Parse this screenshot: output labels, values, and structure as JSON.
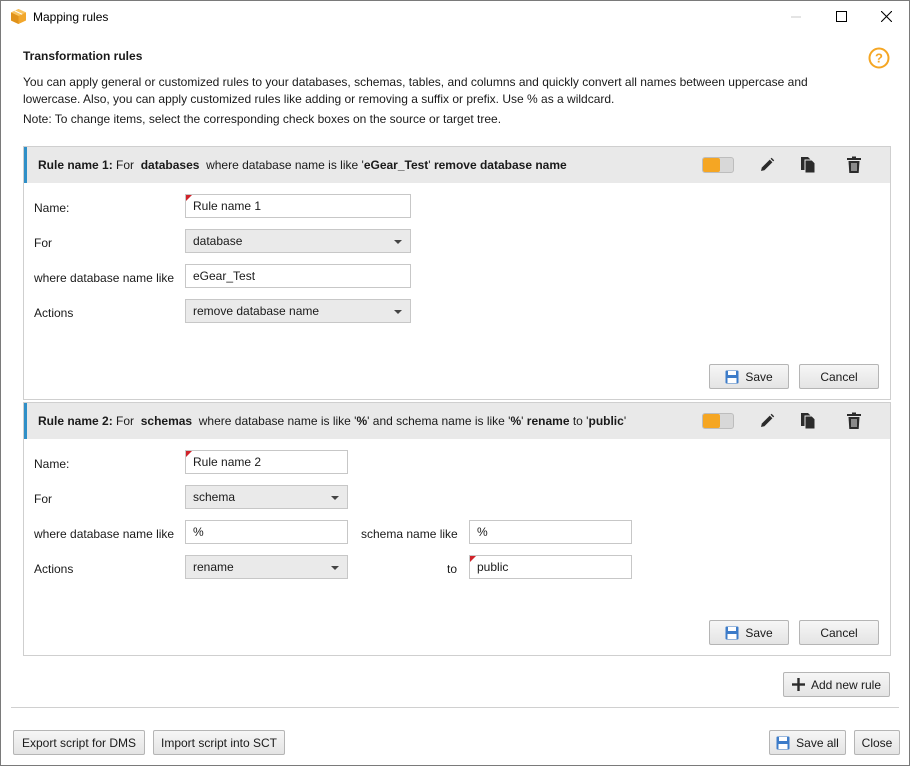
{
  "window": {
    "title": "Mapping rules"
  },
  "section": {
    "title": "Transformation rules",
    "description": "You can apply general or customized rules to your databases, schemas, tables, and columns and quickly convert all names between uppercase and lowercase. Also, you can apply customized rules like adding or removing a suffix or prefix. Use % as a wildcard.",
    "note": "Note: To change items, select the corresponding check boxes on the source or target tree."
  },
  "rule1": {
    "head": {
      "name": "Rule name 1:",
      "for_word": "For",
      "object": "databases",
      "mid": "where database name is like '",
      "pattern": "eGear_Test",
      "q": "'",
      "action": "remove database name"
    },
    "name_label": "Name:",
    "name_value": "Rule name 1",
    "for_label": "For",
    "for_value": "database",
    "where_label": "where database name like",
    "where_value": "eGear_Test",
    "actions_label": "Actions",
    "actions_value": "remove database name",
    "save": "Save",
    "cancel": "Cancel"
  },
  "rule2": {
    "head": {
      "name": "Rule name 2:",
      "for_word": "For",
      "object": "schemas",
      "mid1": "where database name is like '",
      "db_pattern": "%",
      "mid2": "' and schema name is like '",
      "schema_pattern": "%",
      "q": "'",
      "action": "rename",
      "to_word": "to '",
      "target": "public",
      "q2": "'"
    },
    "name_label": "Name:",
    "name_value": "Rule name 2",
    "for_label": "For",
    "for_value": "schema",
    "where_label": "where database name like",
    "where_value": "%",
    "schema_label": "schema name like",
    "schema_value": "%",
    "actions_label": "Actions",
    "actions_value": "rename",
    "to_label": "to",
    "to_value": "public",
    "save": "Save",
    "cancel": "Cancel"
  },
  "buttons": {
    "add_rule": "Add new rule",
    "export": "Export script for DMS",
    "import": "Import script into SCT",
    "save_all": "Save all",
    "close": "Close"
  },
  "colors": {
    "accent": "#f5a623",
    "header_bar": "#2f8fc7",
    "required_marker": "#d0232a"
  },
  "icons": [
    "app-box-icon",
    "minimize-icon",
    "maximize-icon",
    "close-icon",
    "help-icon",
    "edit-icon",
    "copy-icon",
    "delete-icon",
    "save-icon",
    "plus-icon"
  ]
}
